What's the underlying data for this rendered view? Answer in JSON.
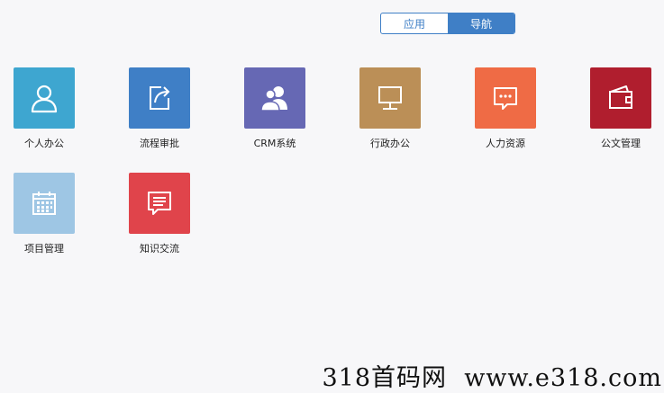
{
  "tabs": [
    {
      "label": "应用",
      "active": false
    },
    {
      "label": "导航",
      "active": true
    }
  ],
  "colors": {
    "accent": "#3f7fc6",
    "tile_personal": "#3ea6d0",
    "tile_process": "#3f7fc6",
    "tile_crm": "#6668b4",
    "tile_admin": "#bb8f57",
    "tile_hr": "#ef6b45",
    "tile_docs": "#b01e2e",
    "tile_project": "#9ec6e4",
    "tile_knowledge": "#e0444b"
  },
  "tiles": [
    {
      "label": "个人办公",
      "icon": "person-icon"
    },
    {
      "label": "流程审批",
      "icon": "share-icon"
    },
    {
      "label": "CRM系统",
      "icon": "users-icon"
    },
    {
      "label": "行政办公",
      "icon": "monitor-icon"
    },
    {
      "label": "人力资源",
      "icon": "chat-dots-icon"
    },
    {
      "label": "公文管理",
      "icon": "wallet-icon"
    },
    {
      "label": "项目管理",
      "icon": "calendar-icon"
    },
    {
      "label": "知识交流",
      "icon": "message-icon"
    }
  ],
  "watermark": "318首码网  www.e318.com"
}
